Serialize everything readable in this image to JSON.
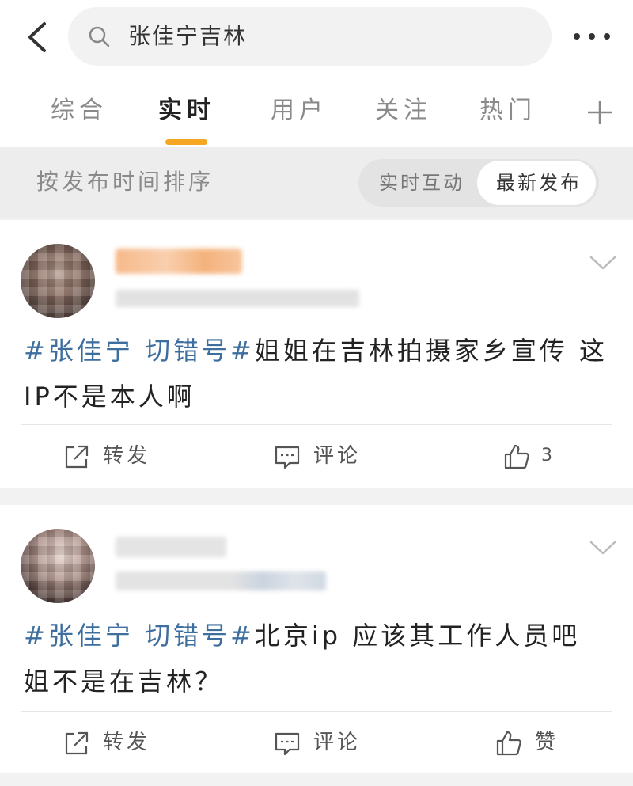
{
  "search": {
    "query": "张佳宁吉林"
  },
  "tabs": [
    {
      "label": "综合"
    },
    {
      "label": "实时"
    },
    {
      "label": "用户"
    },
    {
      "label": "关注"
    },
    {
      "label": "热门"
    }
  ],
  "sort": {
    "label": "按发布时间排序",
    "options": [
      {
        "label": "实时互动"
      },
      {
        "label": "最新发布",
        "selected": true
      }
    ]
  },
  "posts": [
    {
      "tag": "#张佳宁 切错号#",
      "text": "姐姐在吉林拍摄家乡宣传 这IP不是本人啊",
      "actions": {
        "repost": "转发",
        "comment": "评论",
        "like": "3"
      }
    },
    {
      "tag": "#张佳宁 切错号#",
      "text": "北京ip 应该其工作人员吧 姐不是在吉林？",
      "actions": {
        "repost": "转发",
        "comment": "评论",
        "like": "赞"
      }
    }
  ],
  "colors": {
    "accent": "#f5a623",
    "tag": "#3d6e9e"
  }
}
